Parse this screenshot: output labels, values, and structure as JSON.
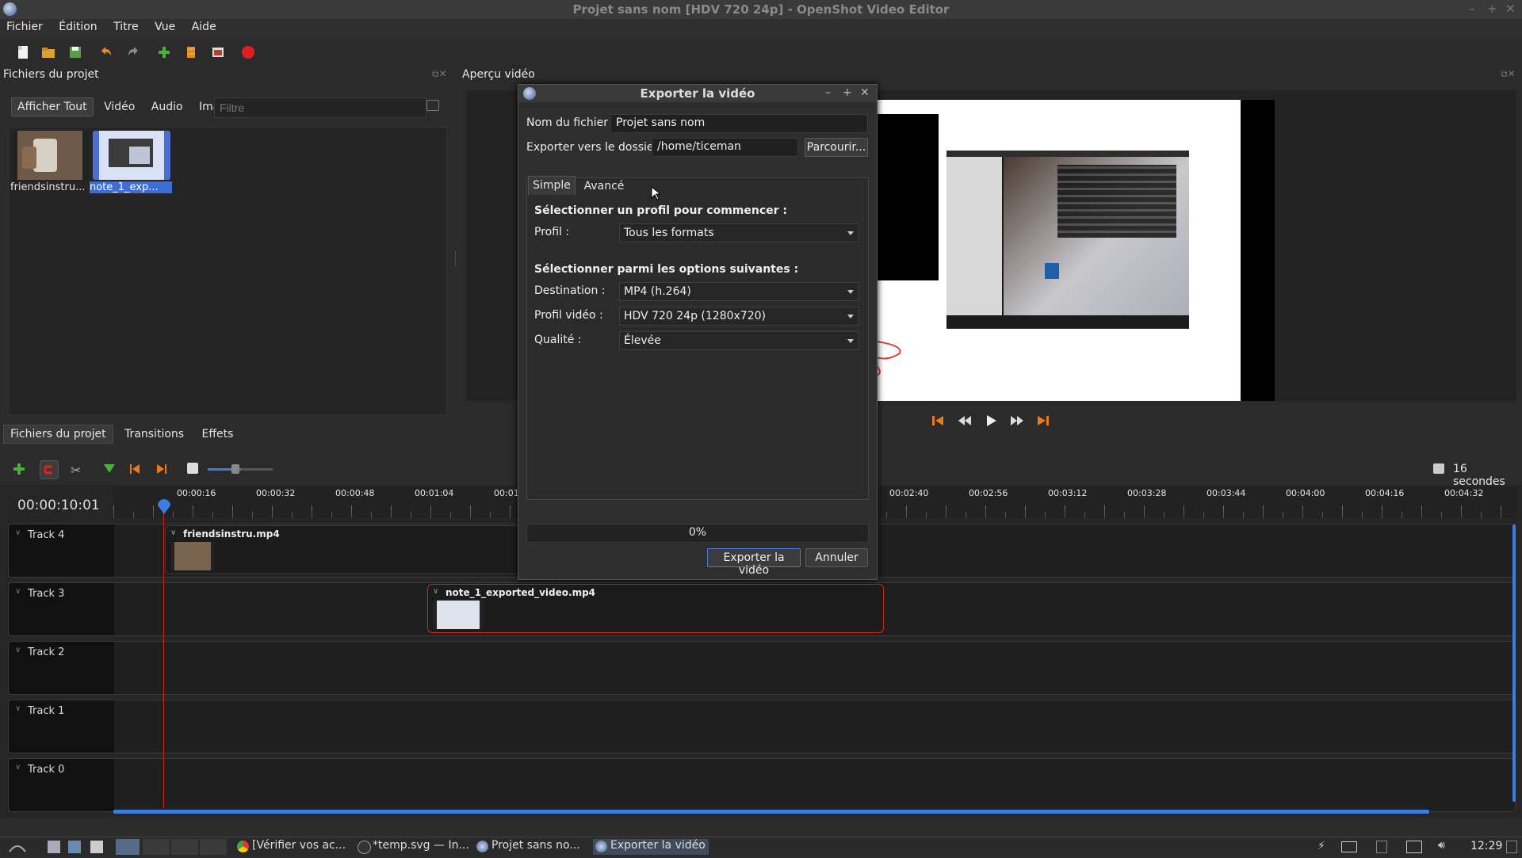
{
  "window": {
    "title": "Projet sans nom [HDV 720 24p] - OpenShot Video Editor",
    "min": "–",
    "max": "+",
    "close": "✕"
  },
  "menu": [
    "Fichier",
    "Édition",
    "Titre",
    "Vue",
    "Aide"
  ],
  "files_panel": {
    "title": "Fichiers du projet",
    "filters": [
      "Afficher Tout",
      "Vidéo",
      "Audio",
      "Image"
    ],
    "filter_placeholder": "Filtre",
    "files": [
      {
        "name": "friendsinstru..."
      },
      {
        "name": "note_1_exp..."
      }
    ]
  },
  "preview_panel": {
    "title": "Aperçu vidéo"
  },
  "bottom_tabs": [
    "Fichiers du projet",
    "Transitions",
    "Effets"
  ],
  "timeline": {
    "timecode": "00:00:10:01",
    "zoom_label": "16 secondes",
    "ticks": [
      "00:00:16",
      "00:00:32",
      "00:00:48",
      "00:01:04",
      "00:01",
      "00:02:40",
      "00:02:56",
      "00:03:12",
      "00:03:28",
      "00:03:44",
      "00:04:00",
      "00:04:16",
      "00:04:32"
    ],
    "tracks": [
      "Track 4",
      "Track 3",
      "Track 2",
      "Track 1",
      "Track 0"
    ],
    "clips": [
      {
        "name": "friendsinstru.mp4"
      },
      {
        "name": "note_1_exported_video.mp4"
      }
    ]
  },
  "dialog": {
    "title": "Exporter la vidéo",
    "filename_label": "Nom du fichier :",
    "filename_value": "Projet sans nom",
    "folder_label": "Exporter vers le dossier",
    "folder_value": "/home/ticeman",
    "browse": "Parcourir...",
    "tabs": [
      "Simple",
      "Avancé"
    ],
    "section1": "Sélectionner un profil pour commencer :",
    "profile_label": "Profil :",
    "profile_value": "Tous les formats",
    "section2": "Sélectionner parmi les options suivantes :",
    "destination_label": "Destination :",
    "destination_value": "MP4 (h.264)",
    "video_profile_label": "Profil vidéo :",
    "video_profile_value": "HDV 720 24p (1280x720)",
    "quality_label": "Qualité :",
    "quality_value": "Élevée",
    "progress": "0%",
    "export_button": "Exporter la vidéo",
    "cancel_button": "Annuler"
  },
  "taskbar": {
    "tasks": [
      "[Vérifier vos ac...",
      "*temp.svg — In...",
      "Projet sans no...",
      "Exporter la vidéo"
    ],
    "clock": "12:29"
  },
  "colors": {
    "accent_orange": "#f07a1a",
    "selection_blue": "#3d6dd8",
    "playhead_red": "#d02020"
  }
}
